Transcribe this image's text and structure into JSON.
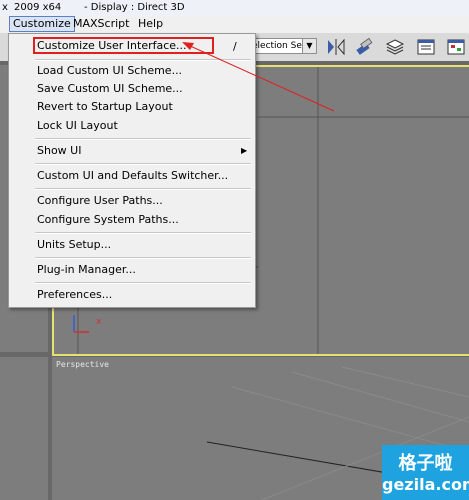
{
  "titlebar": {
    "left_fragment": "x",
    "version": "2009 x64",
    "display": "- Display : Direct 3D"
  },
  "menubar": {
    "items": [
      {
        "label": "Customize",
        "active": true
      },
      {
        "label": "MAXScript",
        "active": false
      },
      {
        "label": "Help",
        "active": false
      }
    ]
  },
  "toolbar": {
    "selection_set": "election Set",
    "selection_arrow": "▼"
  },
  "dropdown": {
    "items": [
      {
        "label": "Customize User Interface...",
        "shortcut": "/"
      },
      {
        "label": "Load Custom UI Scheme..."
      },
      {
        "label": "Save Custom UI Scheme..."
      },
      {
        "label": "Revert to Startup Layout"
      },
      {
        "label": "Lock UI Layout"
      },
      {
        "label": "Show UI",
        "submenu_arrow": "▶"
      },
      {
        "label": "Custom UI and Defaults Switcher..."
      },
      {
        "label": "Configure User Paths..."
      },
      {
        "label": "Configure System Paths..."
      },
      {
        "label": "Units Setup..."
      },
      {
        "label": "Plug-in Manager..."
      },
      {
        "label": "Preferences..."
      }
    ]
  },
  "viewports": {
    "perspective_label": "Perspective",
    "axis_x_label": "x"
  },
  "watermark": {
    "chinese": "格子啦",
    "url": "gezila.com"
  },
  "colors": {
    "highlight_box": "#e0201e",
    "active_viewport_border": "#e8e070",
    "watermark_bg": "#1ea3e0"
  }
}
